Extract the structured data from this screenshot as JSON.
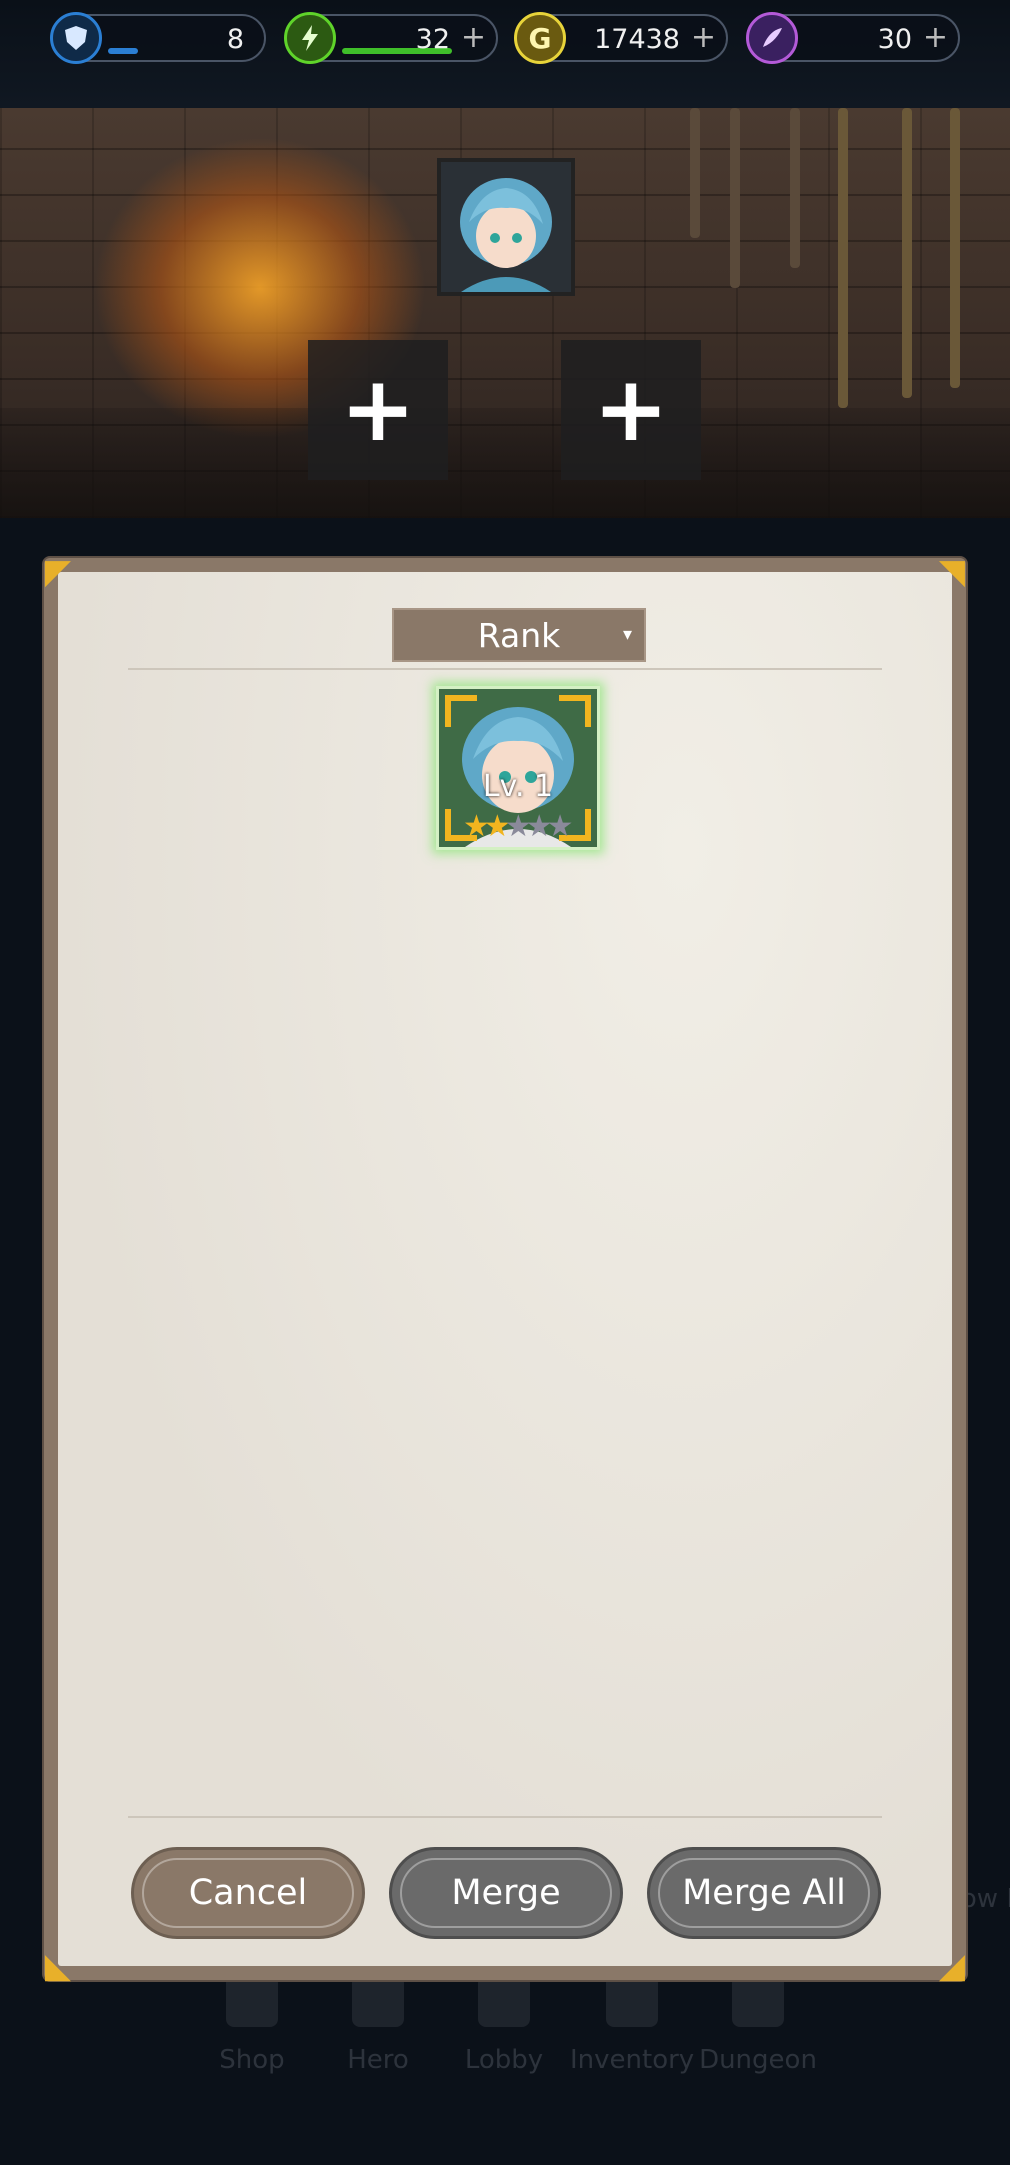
{
  "resources": [
    {
      "icon": "shield-icon",
      "value": "8",
      "color": "#2b7fd4",
      "has_plus": false
    },
    {
      "icon": "lightning-icon",
      "value": "32",
      "color": "#5fd42a",
      "has_plus": true
    },
    {
      "icon": "gold-coin-icon",
      "value": "17438",
      "color": "#e8d43a",
      "has_plus": true
    },
    {
      "icon": "feather-icon",
      "value": "30",
      "color": "#b45ad8",
      "has_plus": true
    }
  ],
  "plus_symbol": "+",
  "panel": {
    "sort_label": "Rank",
    "dropdown_arrow": "▾",
    "hero_card": {
      "level": "Lv. 1",
      "stars_filled": 2,
      "stars_total": 5
    },
    "buttons": {
      "cancel": "Cancel",
      "merge": "Merge",
      "merge_all": "Merge All"
    }
  },
  "nav": [
    {
      "label": "Shop"
    },
    {
      "label": "Hero"
    },
    {
      "label": "Lobby"
    },
    {
      "label": "Inventory"
    },
    {
      "label": "Dungeon"
    }
  ],
  "side_text": "ow I"
}
